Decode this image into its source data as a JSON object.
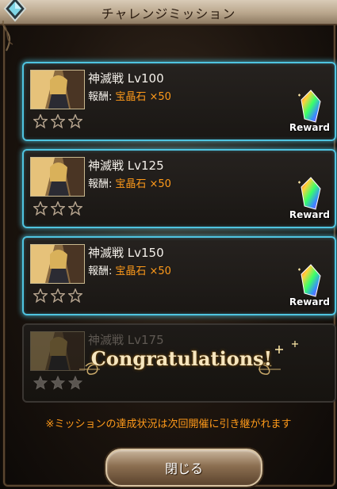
{
  "header": {
    "title": "チャレンジミッション"
  },
  "missions": [
    {
      "name": "神滅戦 Lv100",
      "reward_label": "報酬:",
      "reward_value": "宝晶石 ×50",
      "badge": "Reward",
      "stars_filled": 0,
      "stars_total": 3
    },
    {
      "name": "神滅戦 Lv125",
      "reward_label": "報酬:",
      "reward_value": "宝晶石 ×50",
      "badge": "Reward",
      "stars_filled": 0,
      "stars_total": 3
    },
    {
      "name": "神滅戦 Lv150",
      "reward_label": "報酬:",
      "reward_value": "宝晶石 ×50",
      "badge": "Reward",
      "stars_filled": 0,
      "stars_total": 3
    },
    {
      "name": "神滅戦 Lv175",
      "banner": "Congratulations!",
      "stars_filled": 3,
      "stars_total": 3
    }
  ],
  "notice": "※ミッションの達成状況は次回開催に引き継がれます",
  "close_button": {
    "label": "閉じる"
  },
  "colors": {
    "accent_glow": "#4fc4e0",
    "reward_orange": "#ff9a1a",
    "title_bar": "#c7b59d"
  }
}
